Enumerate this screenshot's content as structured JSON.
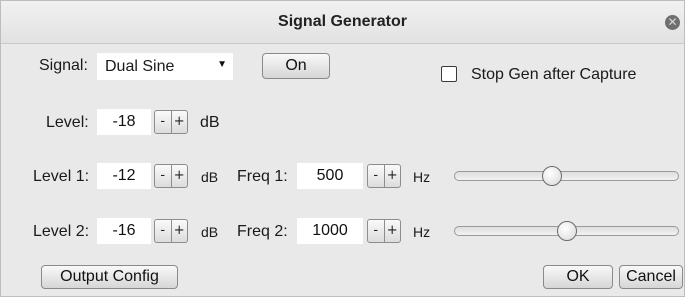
{
  "window": {
    "title": "Signal Generator"
  },
  "signal": {
    "label": "Signal:",
    "selected": "Dual Sine",
    "on_button": "On"
  },
  "stop_gen": {
    "label": "Stop Gen after Capture",
    "checked": false
  },
  "level": {
    "label": "Level:",
    "value": "-18",
    "unit": "dB"
  },
  "channel1": {
    "level_label": "Level 1:",
    "level_value": "-12",
    "level_unit": "dB",
    "freq_label": "Freq 1:",
    "freq_value": "500",
    "freq_unit": "Hz",
    "slider_fraction": 0.43
  },
  "channel2": {
    "level_label": "Level 2:",
    "level_value": "-16",
    "level_unit": "dB",
    "freq_label": "Freq 2:",
    "freq_value": "1000",
    "freq_unit": "Hz",
    "slider_fraction": 0.5
  },
  "stepper": {
    "minus": "-",
    "plus": "+"
  },
  "buttons": {
    "output_config": "Output Config",
    "ok": "OK",
    "cancel": "Cancel"
  },
  "icons": {
    "close": "close-icon",
    "dropdown": "chevron-down-icon"
  }
}
